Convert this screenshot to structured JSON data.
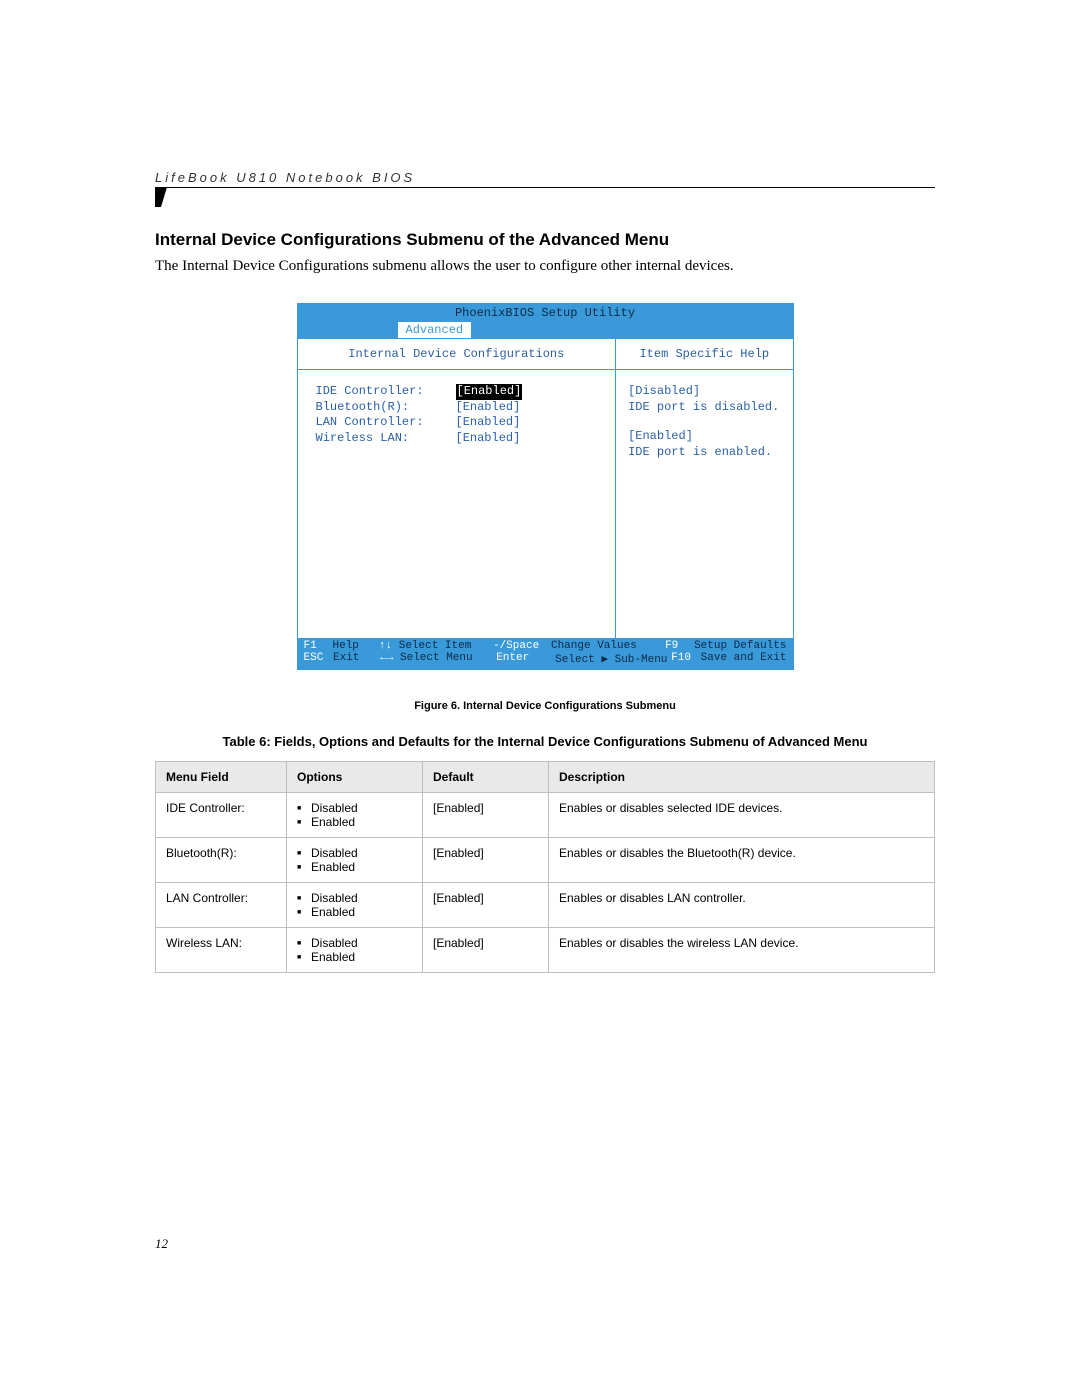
{
  "header": "LifeBook U810 Notebook BIOS",
  "section_title": "Internal Device Configurations Submenu of the Advanced Menu",
  "intro": "The Internal Device Configurations submenu allows the user to configure other internal devices.",
  "bios": {
    "title": "PhoenixBIOS Setup Utility",
    "active_tab": "Advanced",
    "left_heading": "Internal Device Configurations",
    "right_heading": "Item Specific Help",
    "settings": [
      {
        "label": "IDE Controller:",
        "value": "[Enabled]",
        "selected": true
      },
      {
        "label": "Bluetooth(R):",
        "value": "[Enabled]",
        "selected": false
      },
      {
        "label": "LAN Controller:",
        "value": "[Enabled]",
        "selected": false
      },
      {
        "label": "Wireless LAN:",
        "value": "[Enabled]",
        "selected": false
      }
    ],
    "help": [
      {
        "heading": "[Disabled]",
        "text": "IDE port is disabled."
      },
      {
        "heading": "[Enabled]",
        "text": "IDE port is enabled."
      }
    ],
    "footer": {
      "row1": {
        "k1": "F1",
        "l1": "Help",
        "k2": "↑↓",
        "l2": "Select Item",
        "k3": "-/Space",
        "l3": "Change Values",
        "k4": "F9",
        "l4": "Setup Defaults"
      },
      "row2": {
        "k1": "ESC",
        "l1": "Exit",
        "k2": "←→",
        "l2": "Select Menu",
        "k3": "Enter",
        "l3": "Select ▶ Sub-Menu",
        "k4": "F10",
        "l4": "Save and Exit"
      }
    }
  },
  "figure_caption": "Figure 6.   Internal Device Configurations Submenu",
  "table_caption": "Table 6: Fields, Options and Defaults for the Internal Device Configurations Submenu of Advanced Menu",
  "table": {
    "headers": [
      "Menu Field",
      "Options",
      "Default",
      "Description"
    ],
    "rows": [
      {
        "field": "IDE Controller:",
        "options": [
          "Disabled",
          "Enabled"
        ],
        "default": "[Enabled]",
        "desc": "Enables or disables selected IDE devices."
      },
      {
        "field": "Bluetooth(R):",
        "options": [
          "Disabled",
          "Enabled"
        ],
        "default": "[Enabled]",
        "desc": "Enables or disables the Bluetooth(R) device."
      },
      {
        "field": "LAN Controller:",
        "options": [
          "Disabled",
          "Enabled"
        ],
        "default": "[Enabled]",
        "desc": "Enables or disables LAN controller."
      },
      {
        "field": "Wireless LAN:",
        "options": [
          "Disabled",
          "Enabled"
        ],
        "default": "[Enabled]",
        "desc": "Enables or disables the wireless LAN device."
      }
    ]
  },
  "page_number": "12"
}
